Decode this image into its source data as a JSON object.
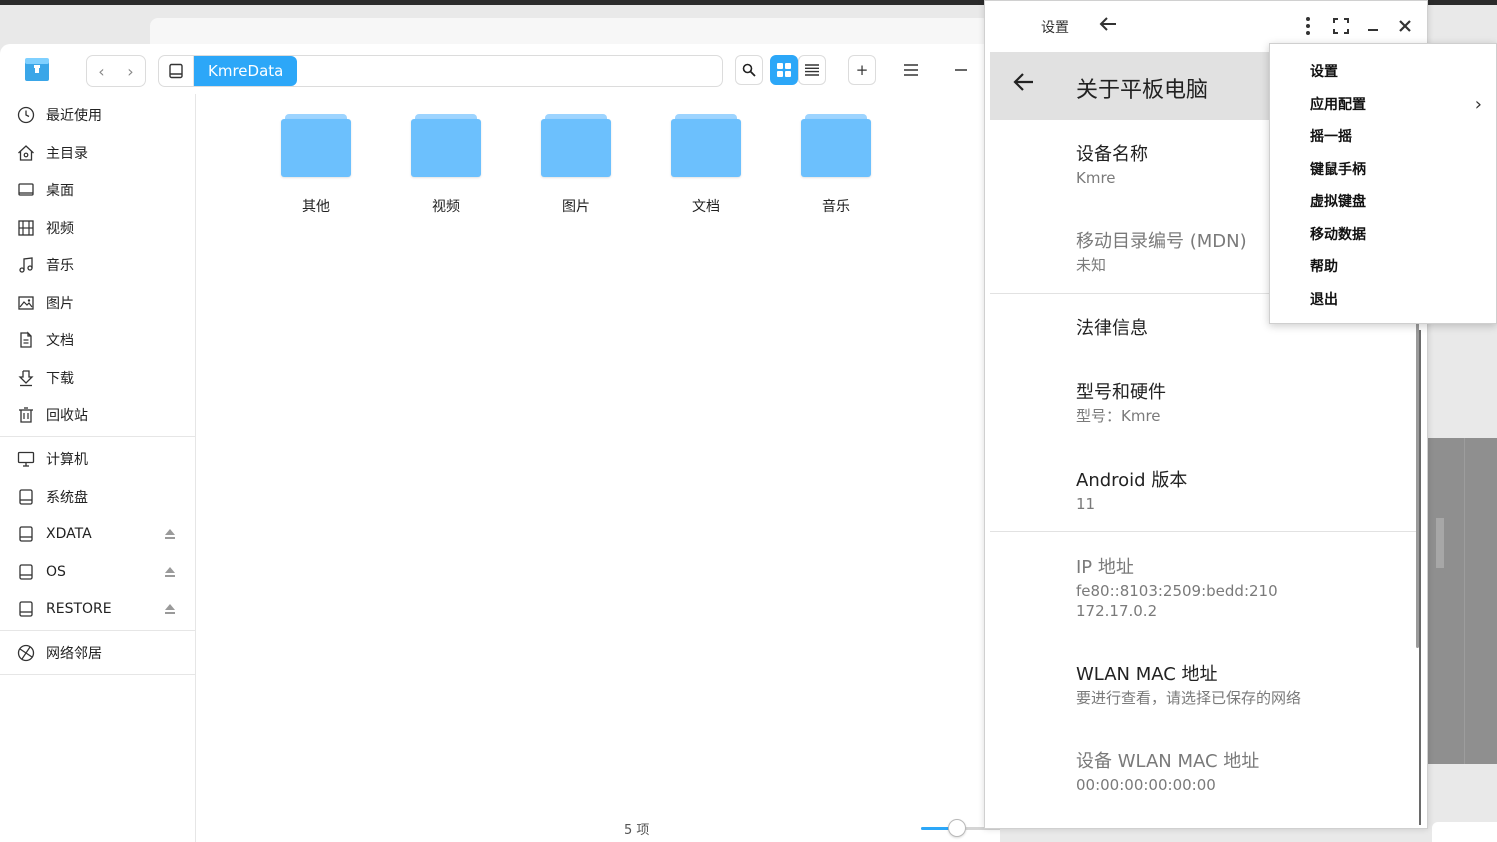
{
  "file_manager": {
    "breadcrumb": "KmreData",
    "sidebar": {
      "items": [
        {
          "label": "最近使用",
          "icon": "clock-icon"
        },
        {
          "label": "主目录",
          "icon": "home-icon"
        },
        {
          "label": "桌面",
          "icon": "desktop-icon"
        },
        {
          "label": "视频",
          "icon": "video-icon"
        },
        {
          "label": "音乐",
          "icon": "music-icon"
        },
        {
          "label": "图片",
          "icon": "image-icon"
        },
        {
          "label": "文档",
          "icon": "document-icon"
        },
        {
          "label": "下载",
          "icon": "download-icon"
        },
        {
          "label": "回收站",
          "icon": "trash-icon"
        }
      ],
      "devices": [
        {
          "label": "计算机",
          "icon": "computer-icon",
          "eject": false
        },
        {
          "label": "系统盘",
          "icon": "disk-icon",
          "eject": false
        },
        {
          "label": "XDATA",
          "icon": "disk-icon",
          "eject": true
        },
        {
          "label": "OS",
          "icon": "disk-icon",
          "eject": true
        },
        {
          "label": "RESTORE",
          "icon": "disk-icon",
          "eject": true
        }
      ],
      "network": {
        "label": "网络邻居",
        "icon": "network-icon"
      }
    },
    "folders": [
      "其他",
      "视频",
      "图片",
      "文档",
      "音乐"
    ],
    "status": "5 项",
    "zoom_fraction": 0.27
  },
  "android_window": {
    "title": "设置",
    "appbar_title": "关于平板电脑",
    "prefs": [
      {
        "title": "设备名称",
        "summary": "Kmre",
        "dim": false
      },
      {
        "title": "移动目录编号 (MDN)",
        "summary": "未知",
        "dim": true
      },
      {
        "title": "法律信息",
        "summary": "",
        "dim": false
      },
      {
        "title": "型号和硬件",
        "summary": "型号：Kmre",
        "dim": false
      },
      {
        "title": "Android 版本",
        "summary": "11",
        "dim": false
      },
      {
        "title": "IP 地址",
        "summary": "fe80::8103:2509:bedd:210",
        "summary2": "172.17.0.2",
        "dim": true
      },
      {
        "title": "WLAN MAC 地址",
        "summary": "要进行查看，请选择已保存的网络",
        "dim": false
      },
      {
        "title": "设备 WLAN MAC 地址",
        "summary": "00:00:00:00:00:00",
        "dim": true
      }
    ]
  },
  "menu": {
    "items": [
      "设置",
      "应用配置",
      "摇一摇",
      "键鼠手柄",
      "虚拟键盘",
      "移动数据",
      "帮助",
      "退出"
    ],
    "submenu_arrow": "›"
  },
  "colors": {
    "accent": "#2ca7f8",
    "folder": "#6cc0fd",
    "appbar": "#e1e1e1"
  }
}
